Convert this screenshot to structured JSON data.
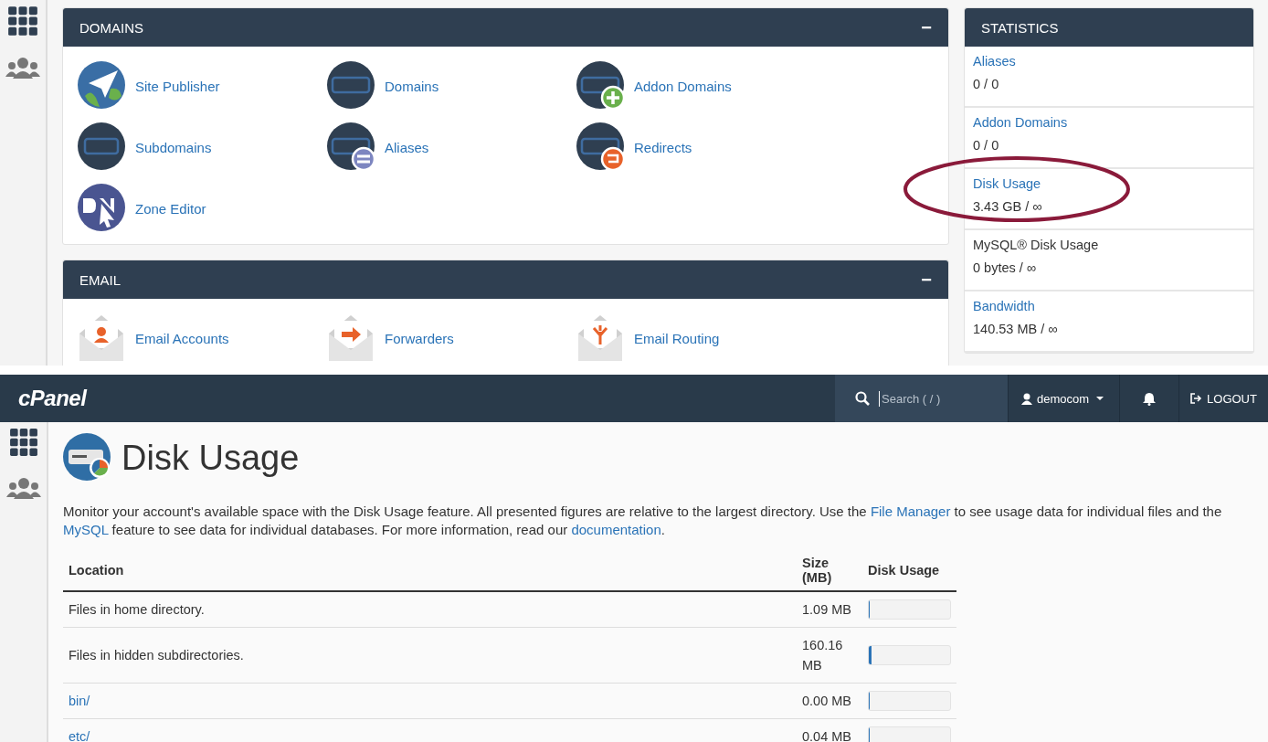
{
  "top": {
    "domains": {
      "title": "DOMAINS",
      "collapse": "−",
      "items": [
        {
          "label": "Site Publisher",
          "kind": "publisher"
        },
        {
          "label": "Domains",
          "kind": "com"
        },
        {
          "label": "Addon Domains",
          "kind": "complus"
        },
        {
          "label": "Subdomains",
          "kind": "sub"
        },
        {
          "label": "Aliases",
          "kind": "comequal"
        },
        {
          "label": "Redirects",
          "kind": "comredirect"
        },
        {
          "label": "Zone Editor",
          "kind": "dns"
        }
      ]
    },
    "email": {
      "title": "EMAIL",
      "collapse": "−",
      "items": [
        {
          "label": "Email Accounts",
          "kind": "person"
        },
        {
          "label": "Forwarders",
          "kind": "arrow"
        },
        {
          "label": "Email Routing",
          "kind": "fork"
        }
      ]
    },
    "statistics": {
      "title": "STATISTICS",
      "rows": [
        {
          "label": "Aliases",
          "value": "0 / 0",
          "kind": "link",
          "highlighted": false
        },
        {
          "label": "Addon Domains",
          "value": "0 / 0",
          "kind": "link",
          "highlighted": false
        },
        {
          "label": "Disk Usage",
          "value": "3.43 GB / ∞",
          "kind": "link",
          "highlighted": true
        },
        {
          "label": "MySQL® Disk Usage",
          "value": "0 bytes / ∞",
          "kind": "text",
          "highlighted": false
        },
        {
          "label": "Bandwidth",
          "value": "140.53 MB / ∞",
          "kind": "link",
          "highlighted": false
        }
      ]
    }
  },
  "bottom": {
    "header": {
      "logo": "cPanel",
      "search_placeholder": "Search ( / )",
      "user": "democom",
      "logout": "LOGOUT"
    },
    "page_title": "Disk Usage",
    "description": [
      {
        "text": "Monitor your account's available space with the Disk Usage feature. All presented figures are relative to the largest directory. Use the ",
        "kind": "text"
      },
      {
        "text": "File Manager",
        "kind": "link"
      },
      {
        "text": " to see usage data for individual files and the ",
        "kind": "text"
      },
      {
        "text": "MySQL",
        "kind": "link"
      },
      {
        "text": " feature to see data for individual databases. For more information, read our ",
        "kind": "text"
      },
      {
        "text": "documentation",
        "kind": "link"
      },
      {
        "text": ".",
        "kind": "text"
      }
    ],
    "table": {
      "columns": [
        "Location",
        "Size (MB)",
        "Disk Usage"
      ],
      "rows": [
        {
          "location": "Files in home directory.",
          "kind": "text",
          "size": "1.09 MB",
          "level": 0
        },
        {
          "location": "Files in hidden subdirectories.",
          "kind": "text",
          "size": "160.16 MB",
          "level": 0.03
        },
        {
          "location": "bin/",
          "kind": "link",
          "size": "0.00 MB",
          "level": 0
        },
        {
          "location": "etc/",
          "kind": "link",
          "size": "0.04 MB",
          "level": 0
        }
      ]
    }
  }
}
